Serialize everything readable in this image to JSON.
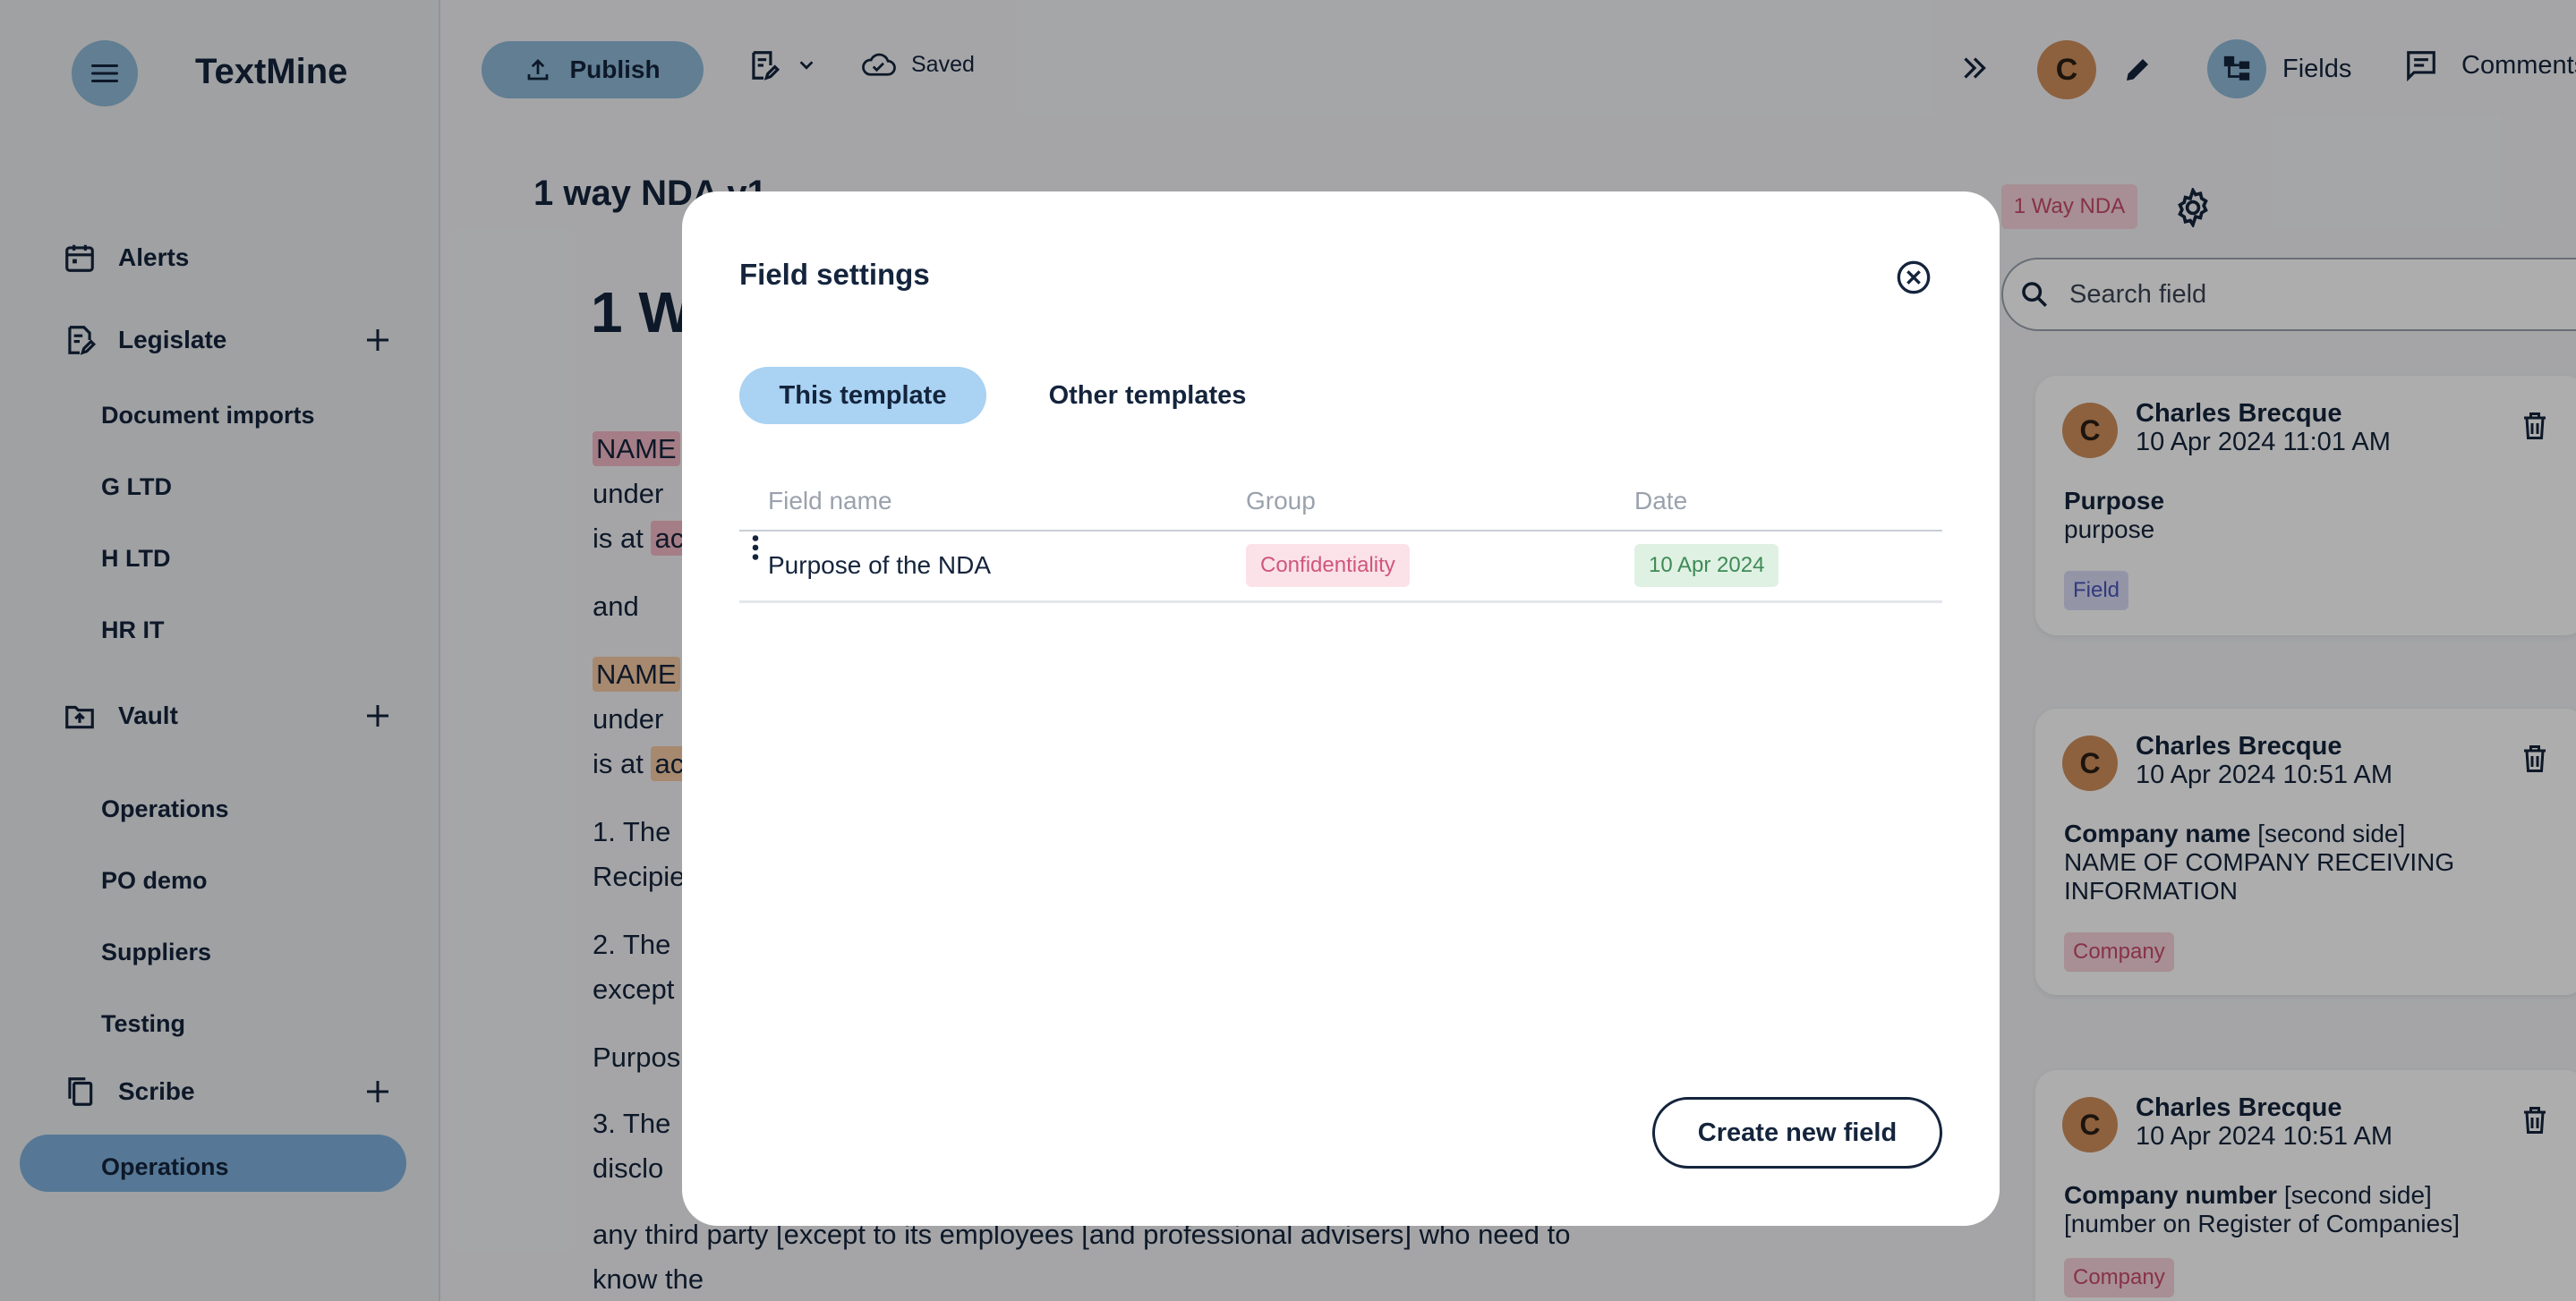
{
  "app": {
    "brand": "TextMine"
  },
  "sidebar": {
    "sections": [
      {
        "label": "Alerts"
      },
      {
        "label": "Legislate",
        "items": [
          "Document imports",
          "G LTD",
          "H LTD",
          "HR IT"
        ]
      },
      {
        "label": "Vault",
        "items": [
          "Operations",
          "PO demo",
          "Suppliers",
          "Testing"
        ]
      },
      {
        "label": "Scribe",
        "items": [
          "Operations"
        ]
      }
    ],
    "active_item": "Operations"
  },
  "toolbar": {
    "publish_label": "Publish",
    "saved_label": "Saved",
    "avatar_initial": "C",
    "fields_label": "Fields",
    "comments_label": "Comments"
  },
  "document": {
    "title_small": "1 way NDA v1",
    "title_big": "1 W",
    "lines": [
      {
        "highlight": "NAME",
        "rest": ""
      },
      {
        "text": "under"
      },
      {
        "text": "is at",
        "highlight": "ac"
      },
      {
        "text": "and"
      },
      {
        "highlight": "NAME",
        "rest": ""
      },
      {
        "text": "under"
      },
      {
        "text": "is at",
        "highlight": "ac"
      },
      {
        "text": "1. The"
      },
      {
        "text": "Recipie"
      },
      {
        "text": "2. The"
      },
      {
        "text": "except"
      },
      {
        "text": "Purpos"
      },
      {
        "text": "3. The"
      },
      {
        "text": "disclo"
      },
      {
        "text": "any third party [except to its employees [and professional advisers] who need to"
      },
      {
        "text": "know the"
      }
    ]
  },
  "right_panel": {
    "template_tag": "1 Way NDA",
    "search_placeholder": "Search field",
    "cards": [
      {
        "initial": "C",
        "author": "Charles Brecque",
        "date": "10 Apr 2024 11:01 AM",
        "field_name": "Purpose",
        "field_side": "",
        "value": "purpose",
        "badge": "Field"
      },
      {
        "initial": "C",
        "author": "Charles Brecque",
        "date": "10 Apr 2024 10:51 AM",
        "field_name": "Company name",
        "field_side": "[second side]",
        "value": "NAME OF COMPANY RECEIVING INFORMATION",
        "badge": "Company"
      },
      {
        "initial": "C",
        "author": "Charles Brecque",
        "date": "10 Apr 2024 10:51 AM",
        "field_name": "Company number",
        "field_side": "[second side]",
        "value": "[number on Register of Companies]",
        "badge": "Company"
      }
    ]
  },
  "modal": {
    "title": "Field settings",
    "tabs": [
      {
        "label": "This template"
      },
      {
        "label": "Other templates"
      }
    ],
    "columns": {
      "name": "Field name",
      "group": "Group",
      "date": "Date"
    },
    "rows": [
      {
        "name": "Purpose of the NDA",
        "group": "Confidentiality",
        "date": "10 Apr 2024"
      }
    ],
    "create_label": "Create new field"
  },
  "colors": {
    "accent": "#8fbad9",
    "tab_active": "#a9d2f3",
    "avatar": "#d08f5c"
  }
}
